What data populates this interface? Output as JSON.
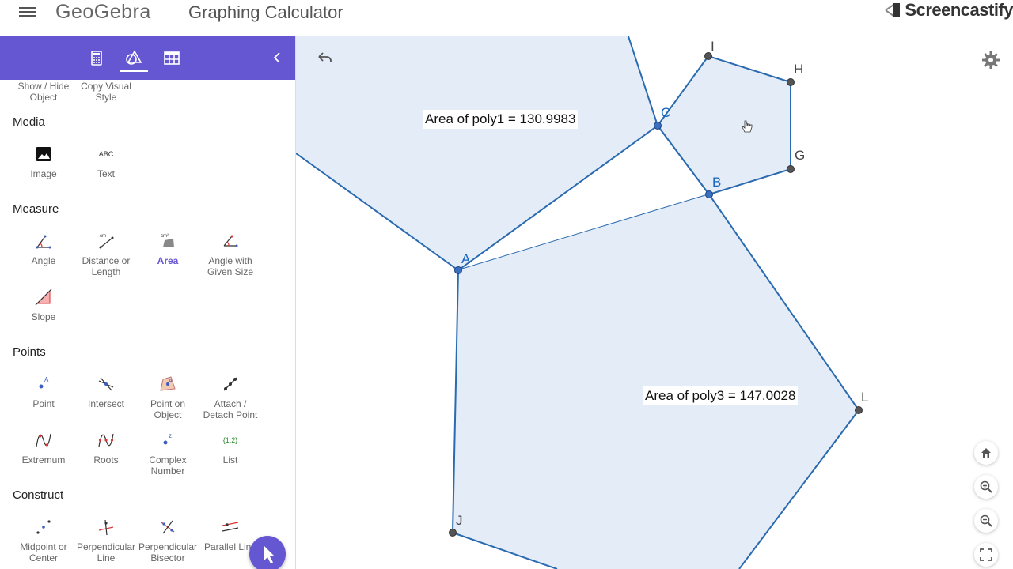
{
  "header": {
    "logo": "GeoGebra",
    "title": "Graphing Calculator",
    "watermark": "Screencastify"
  },
  "sidebar": {
    "tabs": [
      "calculator-tab",
      "tools-tab",
      "table-tab"
    ],
    "sections": {
      "edit_partial": [
        {
          "label": "Show / Hide Object"
        },
        {
          "label": "Copy Visual Style"
        }
      ],
      "media": {
        "title": "Media",
        "tools": [
          {
            "label": "Image",
            "icon": "image-icon"
          },
          {
            "label": "Text",
            "icon": "abc-text-icon",
            "icon_text": "ABC"
          }
        ]
      },
      "measure": {
        "title": "Measure",
        "tools": [
          {
            "label": "Angle"
          },
          {
            "label": "Distance or Length"
          },
          {
            "label": "Area",
            "selected": true
          },
          {
            "label": "Angle with Given Size"
          },
          {
            "label": "Slope"
          }
        ]
      },
      "points": {
        "title": "Points",
        "tools": [
          {
            "label": "Point"
          },
          {
            "label": "Intersect"
          },
          {
            "label": "Point on Object"
          },
          {
            "label": "Attach / Detach Point"
          },
          {
            "label": "Extremum"
          },
          {
            "label": "Roots"
          },
          {
            "label": "Complex Number"
          },
          {
            "label": "List",
            "icon_text": "{1,2}"
          }
        ]
      },
      "construct": {
        "title": "Construct",
        "tools": [
          {
            "label": "Midpoint or Center"
          },
          {
            "label": "Perpendicular Line"
          },
          {
            "label": "Perpendicular Bisector"
          },
          {
            "label": "Parallel Line"
          }
        ]
      }
    }
  },
  "graphics": {
    "labels": {
      "poly1_area": "Area of poly1 = 130.9983",
      "poly3_area": "Area of poly3 = 147.0028"
    },
    "points": {
      "A": "A",
      "B": "B",
      "C": "C",
      "G": "G",
      "H": "H",
      "I": "I",
      "J": "J",
      "L": "L"
    },
    "colors": {
      "accent": "#6557d2",
      "polygon_fill": "#e4edf7",
      "polygon_stroke": "#2a6ab0",
      "point_blue": "#3b6fbf",
      "point_gray": "#555555"
    }
  }
}
